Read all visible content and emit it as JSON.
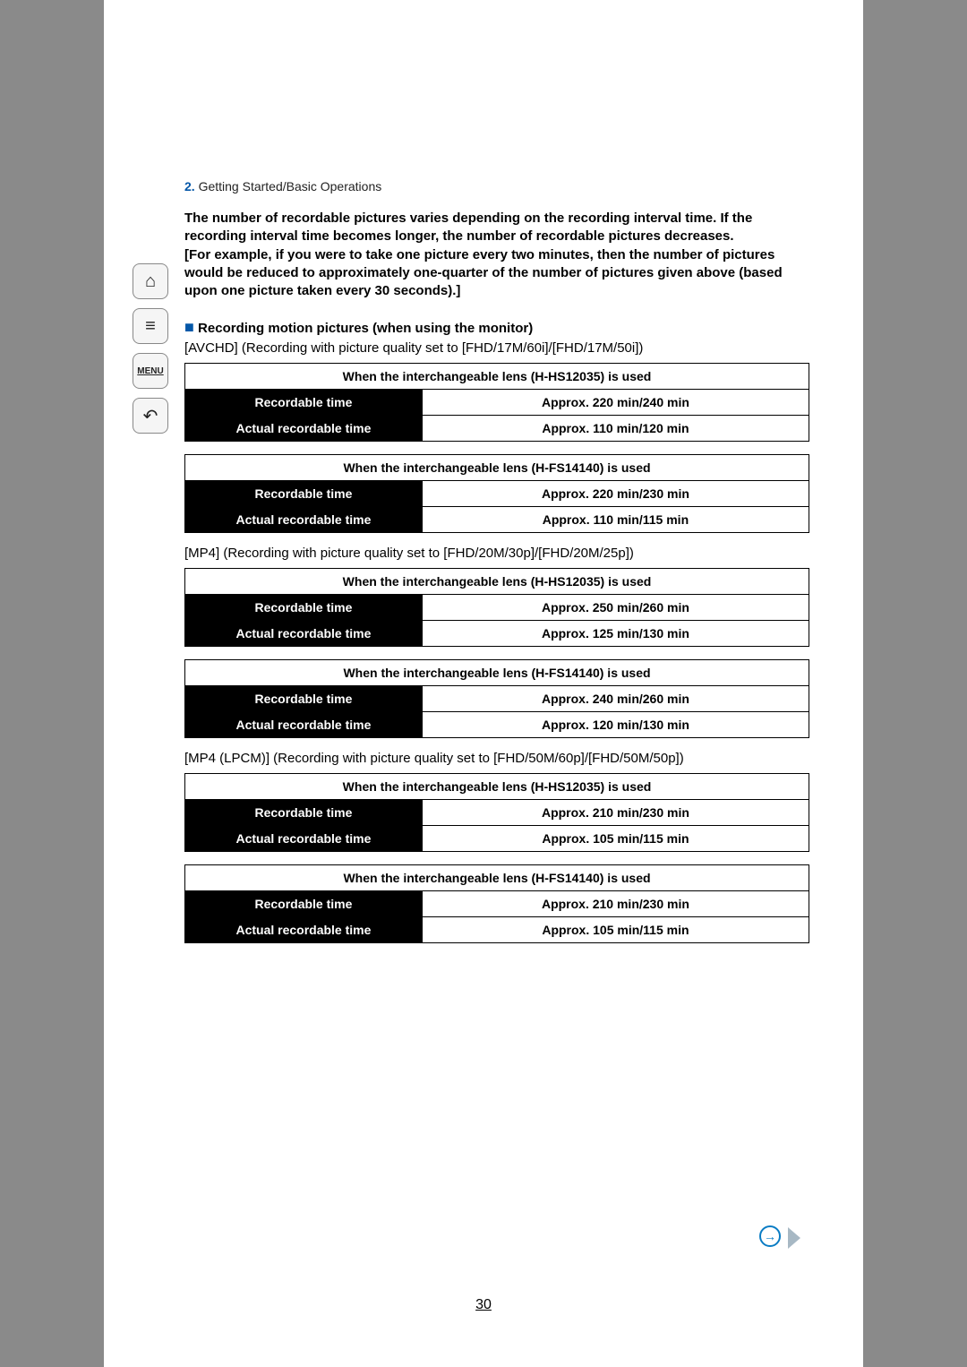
{
  "breadcrumb": {
    "number": "2.",
    "text": "Getting Started/Basic Operations"
  },
  "intro": "The number of recordable pictures varies depending on the recording interval time. If the recording interval time becomes longer, the number of recordable pictures decreases.\n[For example, if you were to take one picture every two minutes, then the number of pictures would be reduced to approximately one-quarter of the number of pictures given above (based upon one picture taken every 30 seconds).]",
  "section_heading": "Recording motion pictures (when using the monitor)",
  "capt_avchd": "[AVCHD] (Recording with picture quality set to [FHD/17M/60i]/[FHD/17M/50i])",
  "capt_mp4": "[MP4] (Recording with picture quality set to [FHD/20M/30p]/[FHD/20M/25p])",
  "capt_lpcm": "[MP4 (LPCM)] (Recording with picture quality set to [FHD/50M/60p]/[FHD/50M/50p])",
  "labels": {
    "rec": "Recordable time",
    "actual": "Actual recordable time"
  },
  "tables": [
    {
      "header": "When the interchangeable lens (H-HS12035) is used",
      "rec": "Approx. 220 min/240 min",
      "actual": "Approx. 110 min/120 min"
    },
    {
      "header": "When the interchangeable lens (H-FS14140) is used",
      "rec": "Approx. 220 min/230 min",
      "actual": "Approx. 110 min/115 min"
    },
    {
      "header": "When the interchangeable lens (H-HS12035) is used",
      "rec": "Approx. 250 min/260 min",
      "actual": "Approx. 125 min/130 min"
    },
    {
      "header": "When the interchangeable lens (H-FS14140) is used",
      "rec": "Approx. 240 min/260 min",
      "actual": "Approx. 120 min/130 min"
    },
    {
      "header": "When the interchangeable lens (H-HS12035) is used",
      "rec": "Approx. 210 min/230 min",
      "actual": "Approx. 105 min/115 min"
    },
    {
      "header": "When the interchangeable lens (H-FS14140) is used",
      "rec": "Approx. 210 min/230 min",
      "actual": "Approx. 105 min/115 min"
    }
  ],
  "nav": {
    "menu": "MENU"
  },
  "page_number": "30"
}
